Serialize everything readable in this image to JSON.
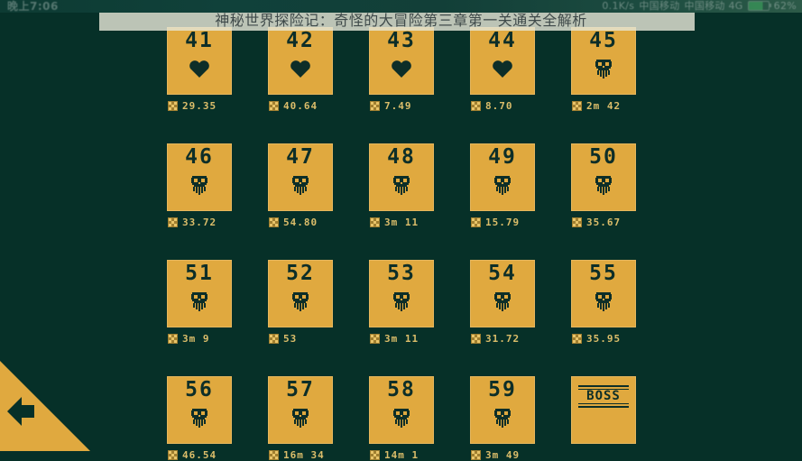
{
  "status_bar": {
    "clock": "晚上7:06",
    "right_items": [
      "0.1K/s",
      "中国移动",
      "中国移动 4G"
    ],
    "battery_percent": "62%"
  },
  "title": "神秘世界探险记：奇怪的大冒险第三章第一关通关全解析",
  "back_button": {
    "icon": "back-arrow-icon",
    "label": ""
  },
  "colors": {
    "background": "#063028",
    "tile": "#e0a93f",
    "tile_text": "#0d2e28",
    "time_text": "#dbbd6a",
    "title_text": "#3f4a4a",
    "title_band": "#e4e5d6"
  },
  "grid": {
    "columns": 5,
    "rows": 4,
    "levels": [
      {
        "number": "41",
        "mark": "heart-icon",
        "time": "29.35"
      },
      {
        "number": "42",
        "mark": "heart-icon",
        "time": "40.64"
      },
      {
        "number": "43",
        "mark": "heart-icon",
        "time": "7.49"
      },
      {
        "number": "44",
        "mark": "heart-icon",
        "time": "8.70"
      },
      {
        "number": "45",
        "mark": "skull-icon",
        "time": "2m 42"
      },
      {
        "number": "46",
        "mark": "skull-icon",
        "time": "33.72"
      },
      {
        "number": "47",
        "mark": "skull-icon",
        "time": "54.80"
      },
      {
        "number": "48",
        "mark": "skull-icon",
        "time": "3m 11"
      },
      {
        "number": "49",
        "mark": "skull-icon",
        "time": "15.79"
      },
      {
        "number": "50",
        "mark": "skull-icon",
        "time": "35.67"
      },
      {
        "number": "51",
        "mark": "skull-icon",
        "time": "3m 9"
      },
      {
        "number": "52",
        "mark": "skull-icon",
        "time": "53"
      },
      {
        "number": "53",
        "mark": "skull-icon",
        "time": "3m 11"
      },
      {
        "number": "54",
        "mark": "skull-icon",
        "time": "31.72"
      },
      {
        "number": "55",
        "mark": "skull-icon",
        "time": "35.95"
      },
      {
        "number": "56",
        "mark": "skull-icon",
        "time": "46.54"
      },
      {
        "number": "57",
        "mark": "skull-icon",
        "time": "16m 34"
      },
      {
        "number": "58",
        "mark": "skull-icon",
        "time": "14m 1"
      },
      {
        "number": "59",
        "mark": "skull-icon",
        "time": "3m 49"
      },
      {
        "number": "BOSS",
        "mark": "boss-plate",
        "time": ""
      }
    ]
  }
}
